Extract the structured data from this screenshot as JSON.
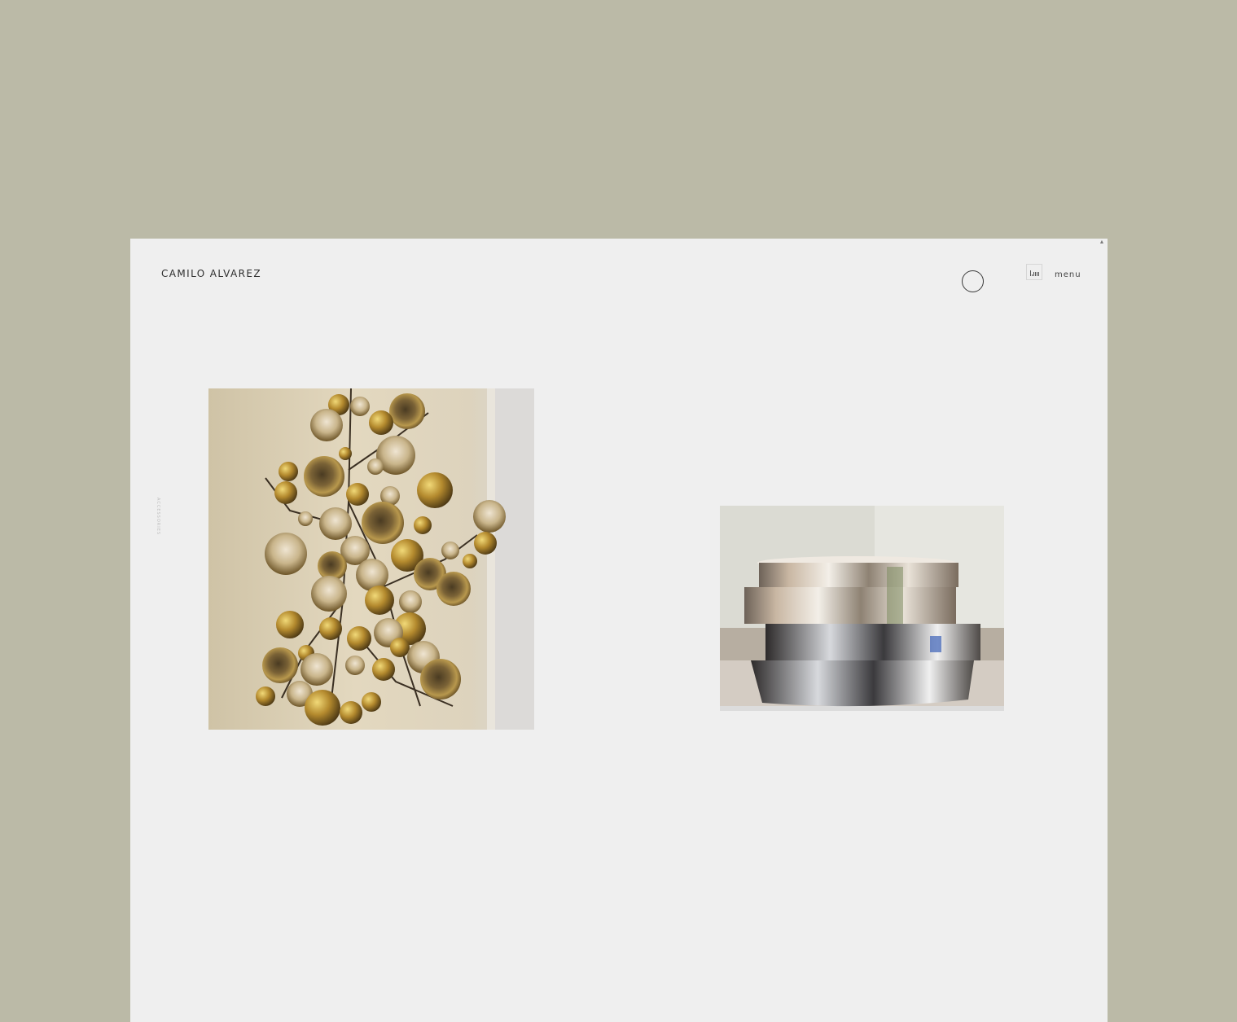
{
  "header": {
    "brand": "CAMILO ALVAREZ",
    "menu_label": "menu"
  },
  "sidebar": {
    "category_label": "ACCESSORIES"
  },
  "gallery": {
    "items": [
      {
        "subject": "brass disc wall sculpture"
      },
      {
        "subject": "stacked polished steel rings sculpture"
      }
    ]
  },
  "icons": {
    "cursor": "cursor-ring-icon",
    "sound": "sound-bars-icon",
    "scroll": "scroll-up-icon"
  },
  "colors": {
    "page_background": "#bbbaa7",
    "window_background": "#efefef",
    "text_dark": "#2e2e2e"
  }
}
